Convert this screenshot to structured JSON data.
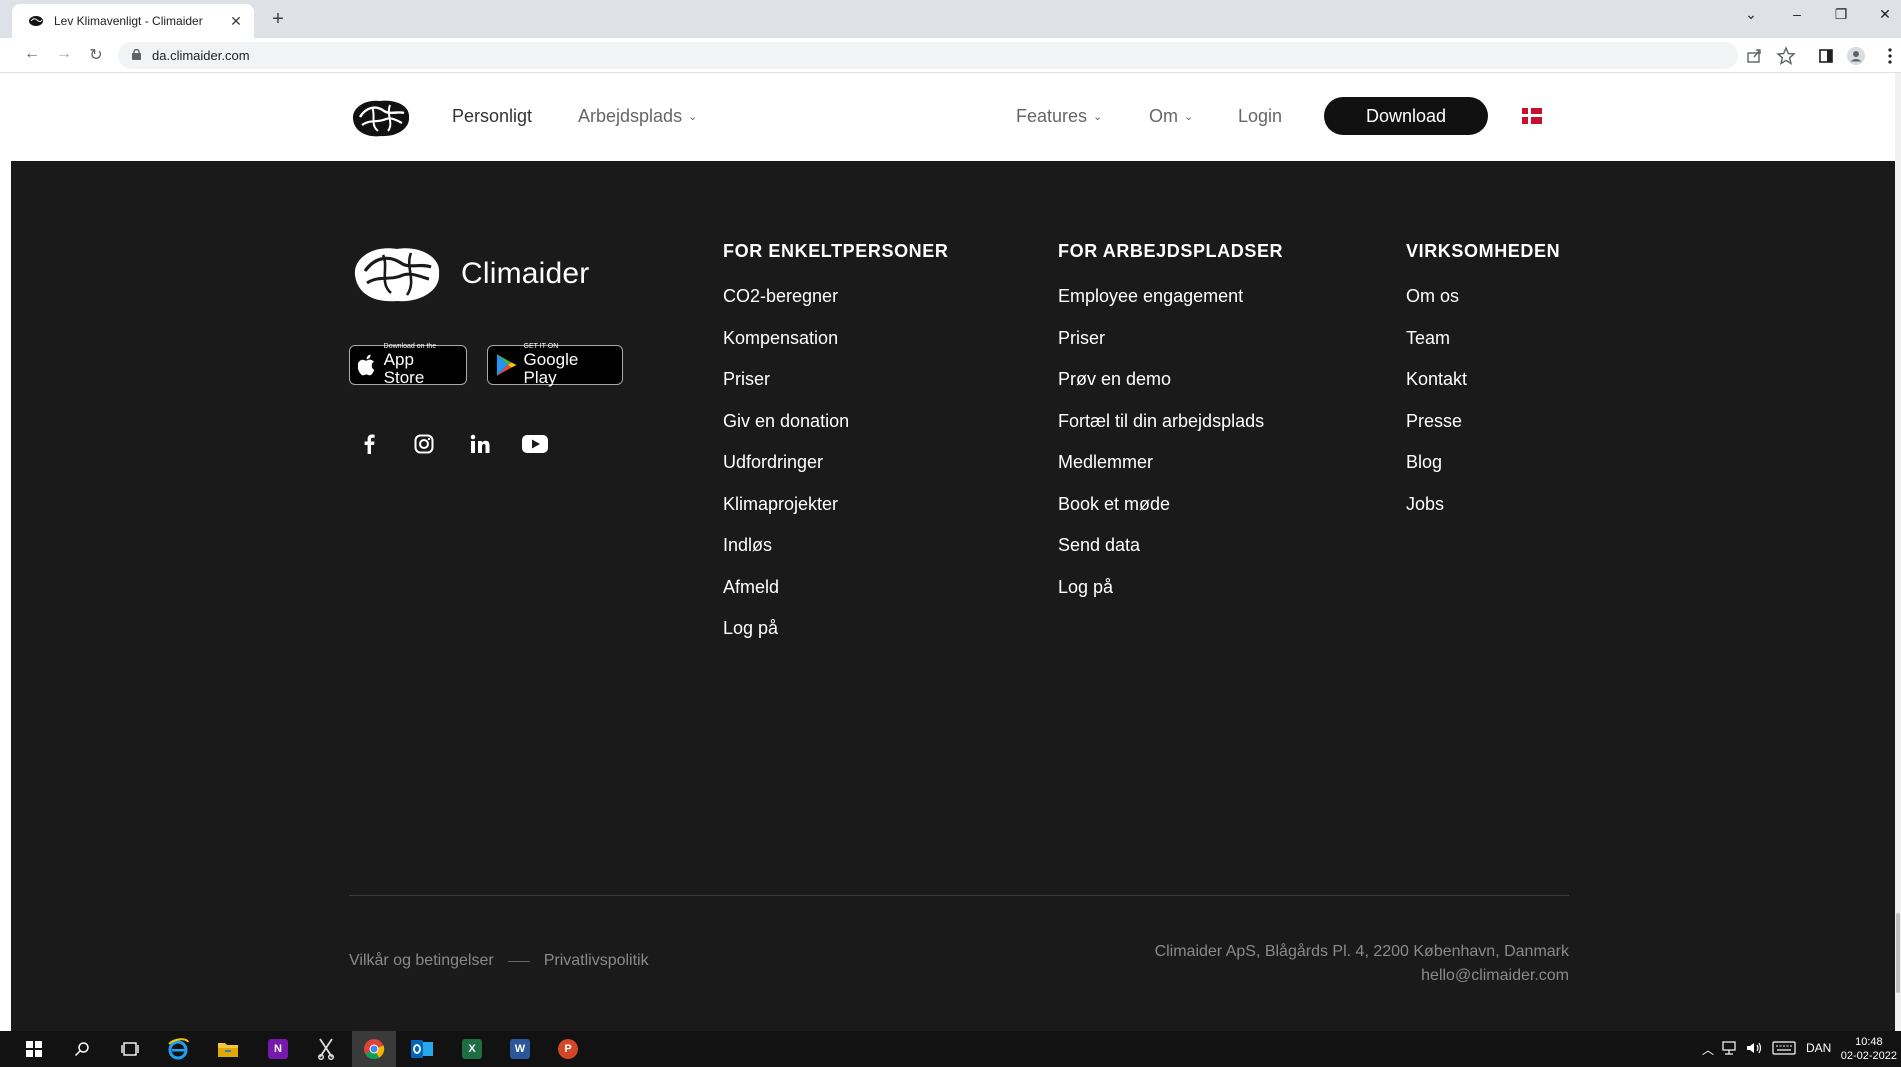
{
  "browser": {
    "tab_title": "Lev Klimavenligt - Climaider",
    "tab_close": "✕",
    "new_tab": "+",
    "url": "da.climaider.com",
    "nav": {
      "back": "←",
      "forward": "→",
      "reload": "↻"
    },
    "window": {
      "dropdown": "⌄",
      "minimize": "–",
      "restore": "❐",
      "close": "✕"
    }
  },
  "header": {
    "nav_left": [
      "Personligt",
      "Arbejdsplads"
    ],
    "nav_right": [
      "Features",
      "Om",
      "Login"
    ],
    "download_label": "Download",
    "chevron": "⌄"
  },
  "footer": {
    "brand": "Climaider",
    "app_store": {
      "small": "Download on the",
      "big": "App Store"
    },
    "google_play": {
      "small": "GET IT ON",
      "big": "Google Play"
    },
    "columns": [
      {
        "heading": "FOR ENKELTPERSONER",
        "items": [
          "CO2-beregner",
          "Kompensation",
          "Priser",
          "Giv en donation",
          "Udfordringer",
          "Klimaprojekter",
          "Indløs",
          "Afmeld",
          "Log på"
        ]
      },
      {
        "heading": "FOR ARBEJDSPLADSER",
        "items": [
          "Employee engagement",
          "Priser",
          "Prøv en demo",
          "Fortæl til din arbejdsplads",
          "Medlemmer",
          "Book et møde",
          "Send data",
          "Log på"
        ]
      },
      {
        "heading": "VIRKSOMHEDEN",
        "items": [
          "Om os",
          "Team",
          "Kontakt",
          "Presse",
          "Blog",
          "Jobs"
        ]
      }
    ],
    "legal": {
      "terms": "Vilkår og betingelser",
      "privacy": "Privatlivspolitik"
    },
    "address": "Climaider ApS, Blågårds Pl. 4, 2200 København, Danmark",
    "email": "hello@climaider.com"
  },
  "taskbar": {
    "language": "DAN",
    "time": "10:48",
    "date": "02-02-2022",
    "apps": [
      {
        "label": "N",
        "color": "#7719aa"
      },
      {
        "label": "X",
        "color": "#1d6f42"
      },
      {
        "label": "W",
        "color": "#2b579a"
      },
      {
        "label": "P",
        "color": "#d24726"
      }
    ]
  },
  "colors": {
    "footer_bg": "#1b1a1a",
    "button_bg": "#111111",
    "flag_red": "#c8102e"
  }
}
